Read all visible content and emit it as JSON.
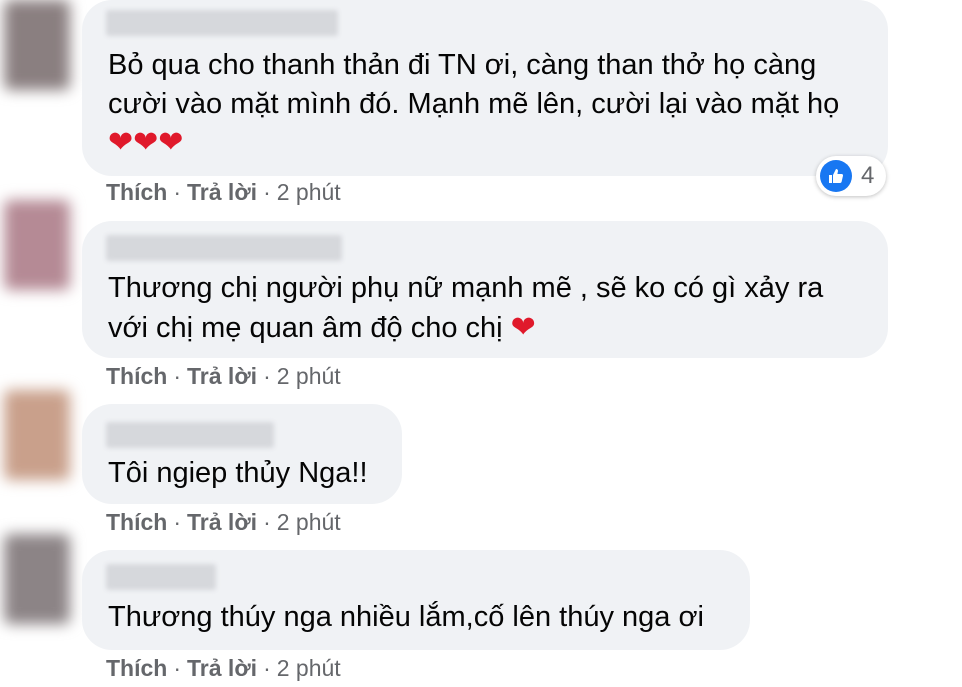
{
  "comments": [
    {
      "author": "",
      "lines": [
        "Bỏ qua cho thanh thản đi TN ơi, càng than thở họ càng",
        "cười vào mặt mình đó. Mạnh mẽ lên, cười lại vào mặt họ"
      ],
      "hearts": "❤❤❤",
      "like_label": "Thích",
      "reply_label": "Trả lời",
      "time": "2 phút",
      "reaction_count": "4",
      "reaction_icon": "like-icon"
    },
    {
      "author": "",
      "lines": [
        "Thương chị người phụ nữ mạnh mẽ , sẽ ko có gì xảy ra",
        "với chị mẹ quan âm độ cho chị"
      ],
      "hearts": "❤",
      "like_label": "Thích",
      "reply_label": "Trả lời",
      "time": "2 phút"
    },
    {
      "author": "",
      "lines": [
        "Tôi ngiep thủy Nga!!"
      ],
      "like_label": "Thích",
      "reply_label": "Trả lời",
      "time": "2 phút"
    },
    {
      "author": "",
      "lines": [
        "Thương thúy nga nhiều lắm,cố lên thúy nga ơi"
      ],
      "like_label": "Thích",
      "reply_label": "Trả lời",
      "time": "2 phút"
    }
  ],
  "separator": "·",
  "colors": {
    "bubble": "#f0f2f5",
    "meta_text": "#65676b",
    "like_blue": "#1877f2",
    "heart_red": "#e0192b"
  }
}
